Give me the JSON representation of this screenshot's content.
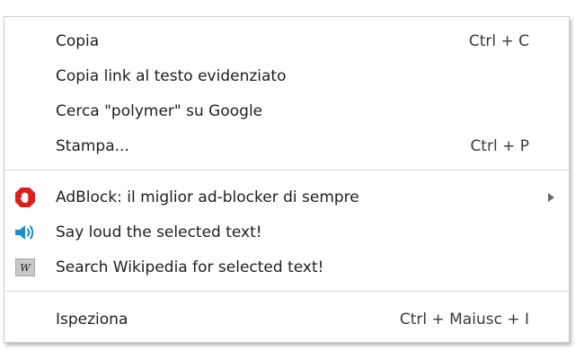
{
  "menu": {
    "section1": [
      {
        "label": "Copia",
        "shortcut": "Ctrl + C"
      },
      {
        "label": "Copia link al testo evidenziato",
        "shortcut": ""
      },
      {
        "label": "Cerca \"polymer\" su Google",
        "shortcut": ""
      },
      {
        "label": "Stampa...",
        "shortcut": "Ctrl + P"
      }
    ],
    "section2": [
      {
        "label": "AdBlock: il miglior ad-blocker di sempre",
        "icon": "adblock-icon",
        "has_submenu": true
      },
      {
        "label": "Say loud the selected text!",
        "icon": "speaker-icon"
      },
      {
        "label": "Search Wikipedia for selected text!",
        "icon": "wikipedia-icon",
        "icon_text": "W"
      }
    ],
    "section3": [
      {
        "label": "Ispeziona",
        "shortcut": "Ctrl + Maiusc + I"
      }
    ]
  },
  "colors": {
    "adblock_red": "#d8211b",
    "speaker_blue": "#1c8bd0",
    "text": "#1e1e1e",
    "separator": "#d9d9d9"
  }
}
